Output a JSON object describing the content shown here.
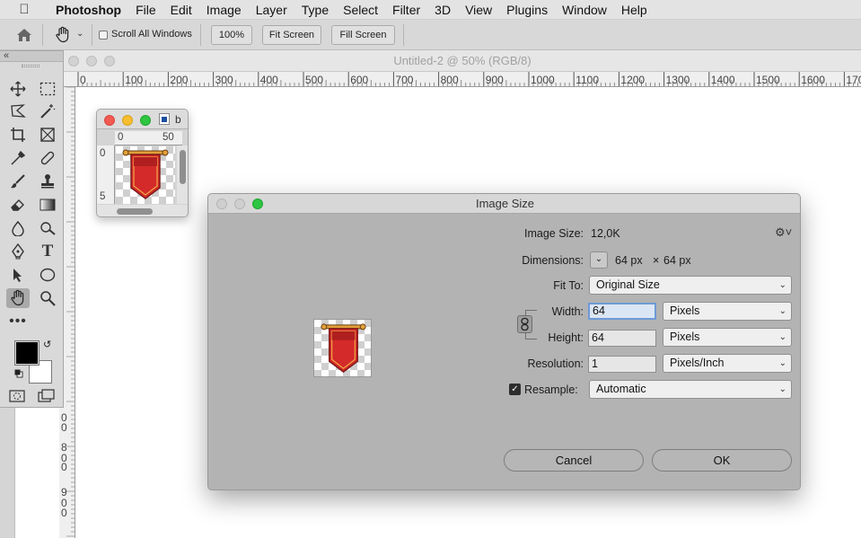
{
  "menubar": {
    "app": "Photoshop",
    "items": [
      "File",
      "Edit",
      "Image",
      "Layer",
      "Type",
      "Select",
      "Filter",
      "3D",
      "View",
      "Plugins",
      "Window",
      "Help"
    ]
  },
  "options": {
    "scroll_all": "Scroll All Windows",
    "zoom": "100%",
    "fit_screen": "Fit Screen",
    "fill_screen": "Fill Screen"
  },
  "document": {
    "title": "Untitled-2 @ 50% (RGB/8)",
    "hruler": [
      "0",
      "100",
      "200",
      "300",
      "400",
      "500",
      "600",
      "700",
      "800",
      "900",
      "1000",
      "1100",
      "1200",
      "1300",
      "1400",
      "1500",
      "1600",
      "1700"
    ],
    "vruler": [
      "0",
      "0",
      "8",
      "0",
      "0",
      "9",
      "0",
      "0"
    ]
  },
  "mini": {
    "tab": "b",
    "ruler_h": [
      "0",
      "50"
    ],
    "ruler_v": [
      "0",
      "5"
    ]
  },
  "dialog": {
    "title": "Image Size",
    "image_size_label": "Image Size:",
    "image_size_value": "12,0K",
    "dimensions_label": "Dimensions:",
    "dim_w": "64 px",
    "dim_x": "×",
    "dim_h": "64 px",
    "fit_label": "Fit To:",
    "fit_value": "Original Size",
    "width_label": "Width:",
    "width_value": "64",
    "width_unit": "Pixels",
    "height_label": "Height:",
    "height_value": "64",
    "height_unit": "Pixels",
    "res_label": "Resolution:",
    "res_value": "1",
    "res_unit": "Pixels/Inch",
    "resample_label": "Resample:",
    "resample_value": "Automatic",
    "cancel": "Cancel",
    "ok": "OK"
  },
  "colors": {
    "banner": "#d42a2a",
    "banner_dark": "#a51c1c",
    "rod": "#e0a23a",
    "green": "#2ec540",
    "red_light": "#f15b54",
    "yellow_light": "#f6be30"
  }
}
